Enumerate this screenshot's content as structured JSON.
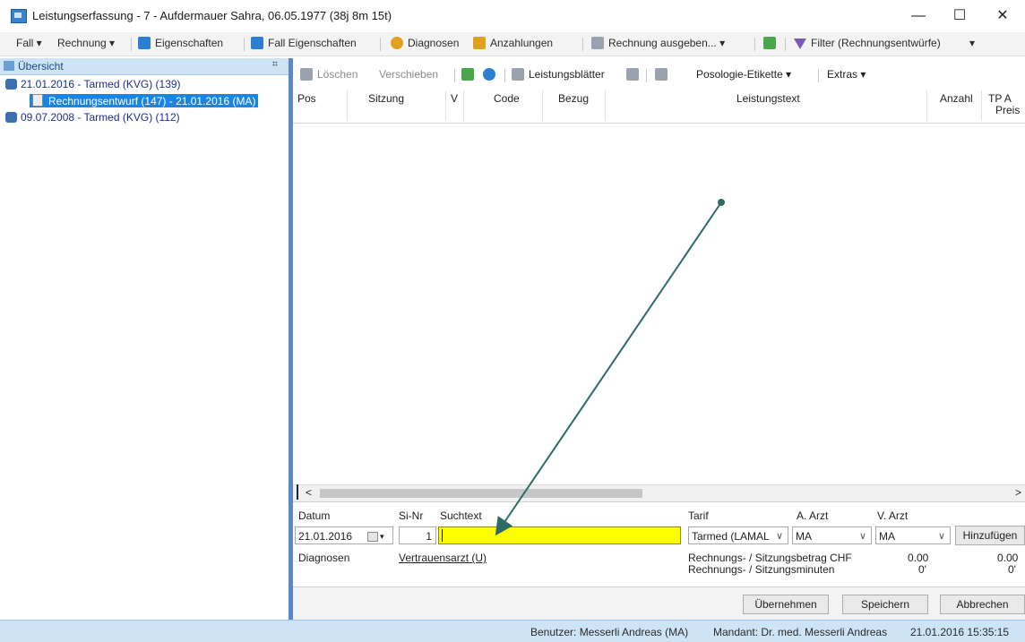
{
  "window": {
    "title": "Leistungserfassung - 7 - Aufdermauer Sahra, 06.05.1977 (38j 8m 15t)",
    "minimize": "—",
    "maximize": "☐",
    "close": "✕"
  },
  "menu": {
    "fall": "Fall ▾",
    "rechnung": "Rechnung ▾",
    "eigenschaften": "Eigenschaften",
    "fall_eigenschaften": "Fall Eigenschaften",
    "diagnosen": "Diagnosen",
    "anzahlungen": "Anzahlungen",
    "rechnung_ausgeben": "Rechnung ausgeben... ▾",
    "filter": "Filter (Rechnungsentwürfe)",
    "filter_arrow": "▾"
  },
  "overview": {
    "header": "Übersicht",
    "pin": "⌗",
    "items": [
      {
        "label": "21.01.2016 - Tarmed (KVG) (139)"
      },
      {
        "label": "Rechnungsentwurf (147) - 21.01.2016 (MA)"
      },
      {
        "label": "09.07.2008 - Tarmed (KVG) (112)"
      }
    ],
    "scroll_left": "<",
    "scroll_right": ">"
  },
  "toolbar": {
    "loeschen": "Löschen",
    "verschieben": "Verschieben",
    "leistungsblaetter": "Leistungsblätter",
    "posologie": "Posologie-Etikette ▾",
    "extras": "Extras ▾"
  },
  "grid": {
    "columns": [
      "Pos",
      "Sitzung",
      "V",
      "Code",
      "Bezug",
      "Leistungstext",
      "Anzahl",
      "TP A",
      "Preis"
    ],
    "scroll_left": "<",
    "scroll_right": ">"
  },
  "form": {
    "datum_label": "Datum",
    "datum_value": "21.01.2016",
    "sinr_label": "Si-Nr",
    "sinr_value": "1",
    "suchtext_label": "Suchtext",
    "suchtext_value": "",
    "tarif_label": "Tarif",
    "tarif_value": "Tarmed (LAMAL",
    "a_arzt_label": "A. Arzt",
    "a_arzt_value": "MA",
    "v_arzt_label": "V. Arzt",
    "v_arzt_value": "MA",
    "hinzufuegen": "Hinzufügen",
    "diagnosen_label": "Diagnosen",
    "vertrauensarzt": "Vertrauensarzt (U)",
    "betrag_label": "Rechnungs- / Sitzungsbetrag CHF",
    "betrag_value1": "0.00",
    "betrag_value2": "0.00",
    "minuten_label": "Rechnungs- / Sitzungsminuten",
    "minuten_value1": "0'",
    "minuten_value2": "0'"
  },
  "buttons": {
    "uebernehmen": "Übernehmen",
    "speichern": "Speichern",
    "abbrechen": "Abbrechen"
  },
  "status": {
    "benutzer": "Benutzer: Messerli Andreas  (MA)",
    "mandant": "Mandant: Dr. med. Messerli Andreas",
    "datetime": "21.01.2016 15:35:15"
  },
  "colors": {
    "selection": "#1a84e2",
    "search_highlight": "#ffff00",
    "arrow": "#2e6b68",
    "statusbar": "#cde3f6"
  }
}
